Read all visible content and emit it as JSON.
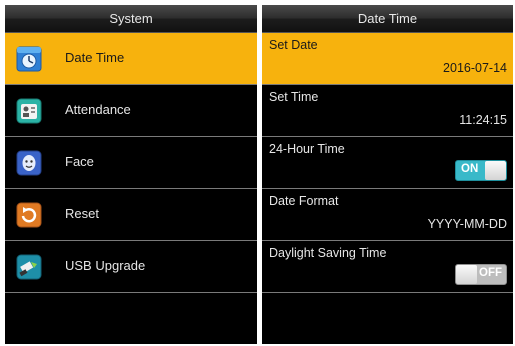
{
  "system_panel": {
    "title": "System",
    "items": [
      {
        "label": "Date Time",
        "icon": "clock-calendar-icon",
        "selected": true
      },
      {
        "label": "Attendance",
        "icon": "attendance-icon"
      },
      {
        "label": "Face",
        "icon": "face-icon"
      },
      {
        "label": "Reset",
        "icon": "reset-icon"
      },
      {
        "label": "USB Upgrade",
        "icon": "usb-upgrade-icon"
      }
    ]
  },
  "datetime_panel": {
    "title": "Date Time",
    "set_date": {
      "label": "Set Date",
      "value": "2016-07-14"
    },
    "set_time": {
      "label": "Set Time",
      "value": "11:24:15"
    },
    "hour24": {
      "label": "24-Hour Time",
      "toggle": "ON"
    },
    "date_format": {
      "label": "Date Format",
      "value": "YYYY-MM-DD"
    },
    "dst": {
      "label": "Daylight Saving Time",
      "toggle": "OFF"
    }
  },
  "colors": {
    "highlight": "#f7b20d",
    "background": "#000000",
    "toggle_on": "#39b9c9",
    "toggle_off": "#bdbdbd",
    "separator": "#7a7a7a"
  }
}
